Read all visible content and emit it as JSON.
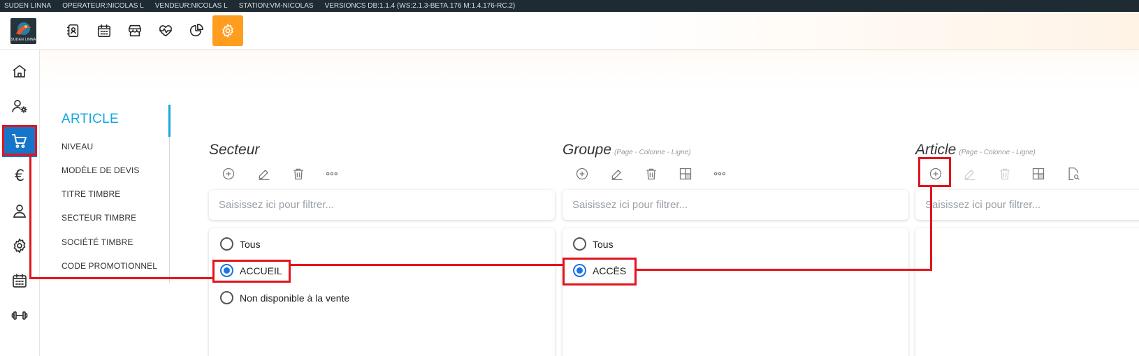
{
  "status_bar": {
    "site": "SUDEN LINNA",
    "operator": "OPERATEUR:NICOLAS L",
    "seller": "VENDEUR:NICOLAS L",
    "station": "STATION:VM-NICOLAS",
    "versions": "VERSIONCS DB:1.1.4 (WS:2.1.3-BETA.176 M:1.4.176-RC.2)"
  },
  "logo": {
    "text": "SUDEN LINNA"
  },
  "top_nav": {
    "icons": [
      "contacts-book-icon",
      "calendar-icon",
      "store-icon",
      "heart-pulse-icon",
      "pie-chart-icon",
      "gear-icon"
    ],
    "active": "gear-icon",
    "accent_color": "#ff9d1f"
  },
  "sidebar": {
    "icons": [
      "home-icon",
      "user-settings-icon",
      "cart-icon",
      "euro-icon",
      "user-icon",
      "gear-icon",
      "calendar-icon",
      "dumbbell-icon"
    ],
    "active": "cart-icon",
    "euro_glyph": "€",
    "active_color": "#1775c9"
  },
  "submenu": {
    "title": "ARTICLE",
    "items": [
      "NIVEAU",
      "MODÈLE DE DEVIS",
      "TITRE TIMBRE",
      "SECTEUR TIMBRE",
      "SOCIÉTÉ TIMBRE",
      "CODE PROMOTIONNEL"
    ]
  },
  "panels": {
    "secteur": {
      "title": "Secteur",
      "subtitle": "",
      "filter_placeholder": "Saisissez ici pour filtrer...",
      "options": [
        "Tous",
        "ACCUEIL",
        "Non disponible à la vente"
      ],
      "selected": "ACCUEIL"
    },
    "groupe": {
      "title": "Groupe",
      "subtitle": "(Page - Colonne - Ligne)",
      "filter_placeholder": "Saisissez ici pour filtrer...",
      "options": [
        "Tous",
        "ACCÈS"
      ],
      "selected": "ACCÈS"
    },
    "article": {
      "title": "Article",
      "subtitle": "(Page - Colonne - Ligne)",
      "filter_placeholder": "Saisissez ici pour filtrer..."
    }
  },
  "annotation_color": "#e3141d"
}
